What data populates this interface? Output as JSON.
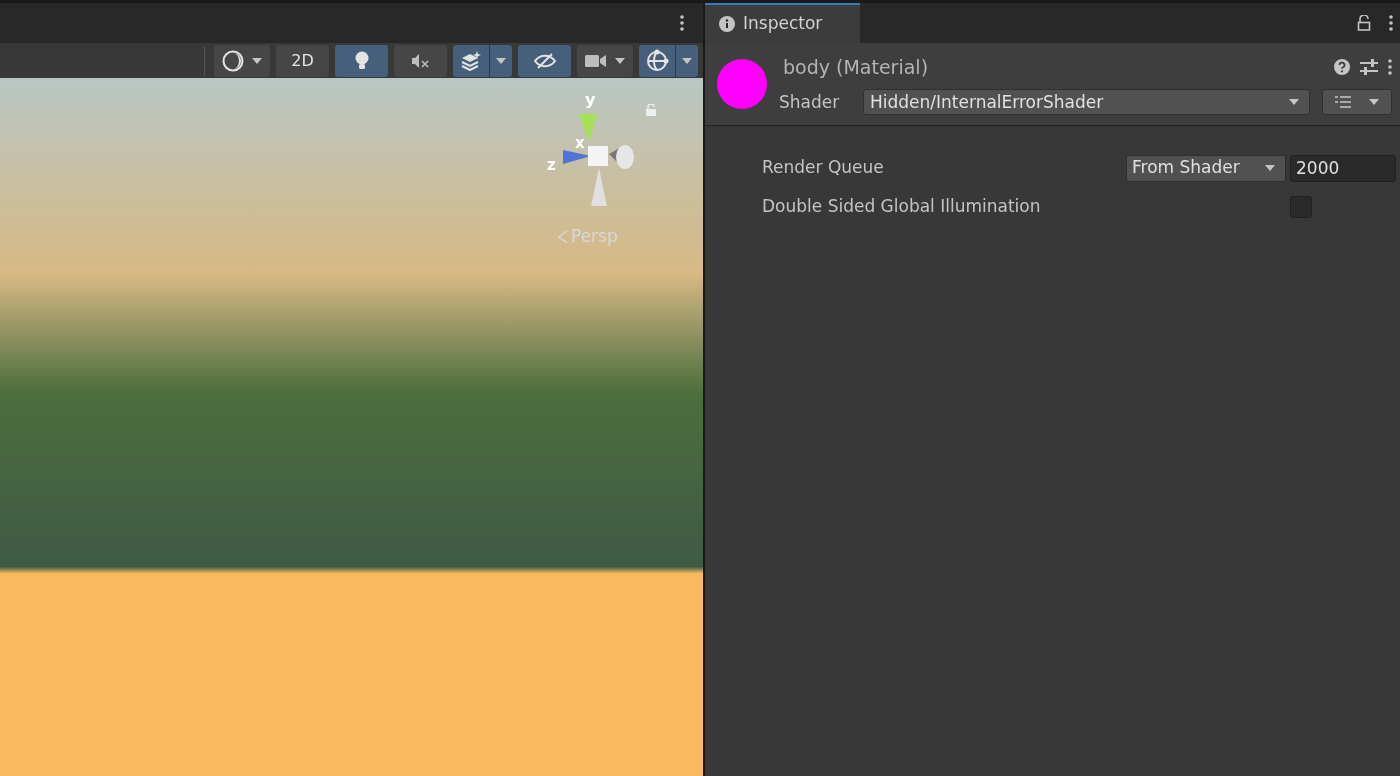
{
  "scene_toolbar": {
    "buttons": [
      {
        "kind": "shading",
        "on": false
      },
      {
        "kind": "label",
        "label": "2D",
        "on": false
      },
      {
        "kind": "lighting",
        "on": true
      },
      {
        "kind": "audio",
        "on": false
      },
      {
        "kind": "effects",
        "on": true
      },
      {
        "kind": "visibility",
        "on": true
      },
      {
        "kind": "camera",
        "on": false
      },
      {
        "kind": "gizmos",
        "on": true
      }
    ]
  },
  "scene_gizmo": {
    "axes": [
      "y",
      "x",
      "z"
    ],
    "projection": "Persp"
  },
  "inspector": {
    "tab": {
      "label": "Inspector",
      "selected": true
    },
    "material": {
      "title": "body (Material)",
      "color": "#ff00ff",
      "shader_label": "Shader",
      "shader": "Hidden/InternalErrorShader"
    },
    "properties": [
      {
        "kind": "queue",
        "label": "Render Queue",
        "mode": "From Shader",
        "value": "2000"
      },
      {
        "kind": "checkbox",
        "label": "Double Sided Global Illumination",
        "checked": false
      }
    ]
  }
}
